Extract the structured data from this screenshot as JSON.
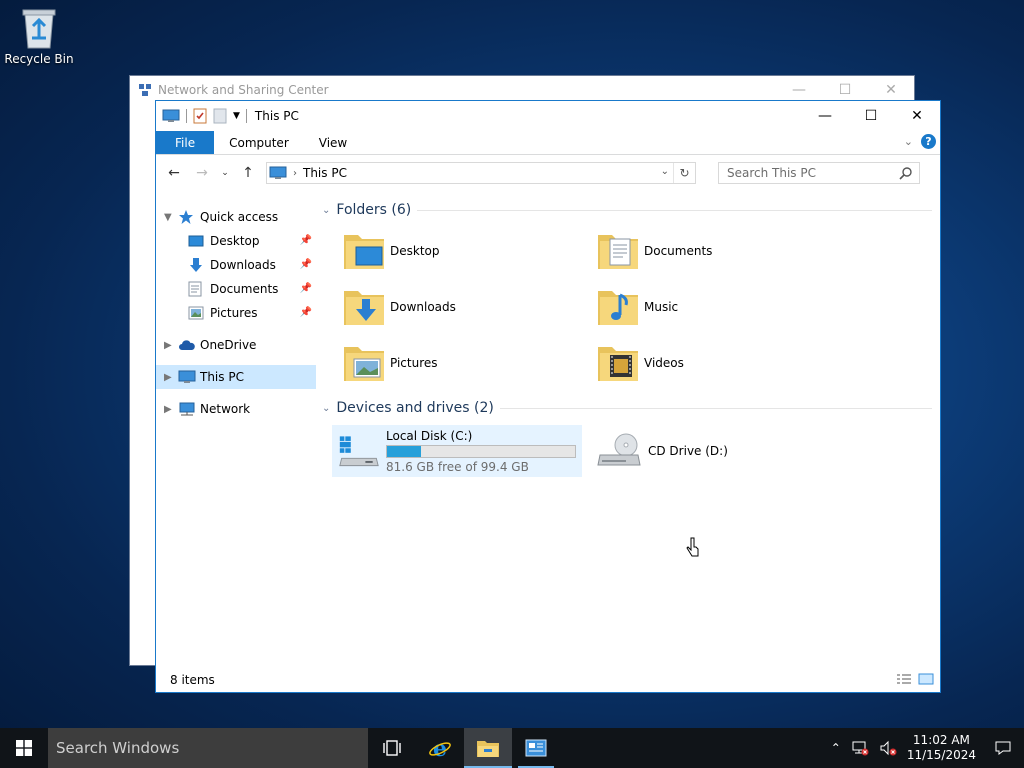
{
  "desktop": {
    "recycle_bin_label": "Recycle Bin"
  },
  "background_window": {
    "title": "Network and Sharing Center"
  },
  "explorer": {
    "title": "This PC",
    "ribbon_tabs": {
      "file": "File",
      "computer": "Computer",
      "view": "View"
    },
    "help_label": "?",
    "address": {
      "location": "This PC"
    },
    "search": {
      "placeholder": "Search This PC"
    },
    "nav": {
      "quick_access": "Quick access",
      "desktop": "Desktop",
      "downloads": "Downloads",
      "documents": "Documents",
      "pictures": "Pictures",
      "onedrive": "OneDrive",
      "this_pc": "This PC",
      "network": "Network"
    },
    "folders_group": "Folders (6)",
    "folders": {
      "desktop": "Desktop",
      "documents": "Documents",
      "downloads": "Downloads",
      "music": "Music",
      "pictures": "Pictures",
      "videos": "Videos"
    },
    "devices_group": "Devices and drives (2)",
    "drives": {
      "c": {
        "name": "Local Disk (C:)",
        "free_text": "81.6 GB free of 99.4 GB",
        "used_fraction": 0.179
      },
      "d": {
        "name": "CD Drive (D:)"
      }
    },
    "status_text": "8 items"
  },
  "taskbar": {
    "search_placeholder": "Search Windows",
    "time": "11:02 AM",
    "date": "11/15/2024"
  },
  "colors": {
    "accent": "#1979ca",
    "drive_fill": "#26a0da",
    "selection": "#cce8ff"
  }
}
